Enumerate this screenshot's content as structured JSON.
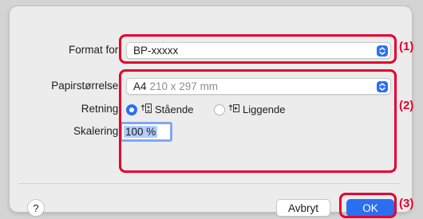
{
  "format_for": {
    "label": "Format for:",
    "value": "BP-xxxxx"
  },
  "paper_size": {
    "label": "Papirstørrelse:",
    "value": "A4",
    "dimensions": "210 x 297 mm"
  },
  "orientation": {
    "label": "Retning:",
    "portrait_label": "Stående",
    "landscape_label": "Liggende",
    "selected": "portrait"
  },
  "scale": {
    "label": "Skalering:",
    "value": "100 %"
  },
  "buttons": {
    "help": "?",
    "cancel": "Avbryt",
    "ok": "OK"
  },
  "callouts": [
    "(1)",
    "(2)",
    "(3)"
  ],
  "colors": {
    "accent": "#2a6ff1",
    "highlight": "#e5002e"
  }
}
